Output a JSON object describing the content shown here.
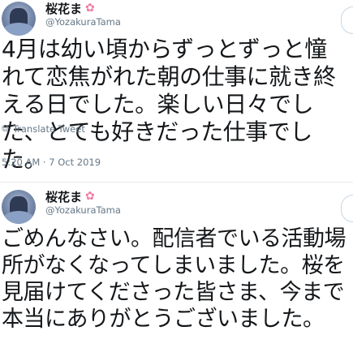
{
  "tweets": [
    {
      "author_name": "桜花ま",
      "author_emoji": "✿",
      "handle": "@YozakuraTama",
      "text": "4月は幼い頃からずっとずっと憧れて恋焦がれた朝の仕事に就き終える日でした。楽しい日々でした、とても好きだった仕事でした。",
      "translate_label": "Translate Tweet",
      "translate_icon": "globe-icon",
      "timestamp": "5:20 AM · 7 Oct 2019"
    },
    {
      "author_name": "桜花ま",
      "author_emoji": "✿",
      "handle": "@YozakuraTama",
      "text": "ごめんなさい。配信者でいる活動場所がなくなってしまいました。桜を見届けてくださった皆さま、今まで本当にありがとうございました。"
    }
  ],
  "colors": {
    "text": "#14171a",
    "secondary": "#657786",
    "accent_pink": "#f07ba5"
  }
}
